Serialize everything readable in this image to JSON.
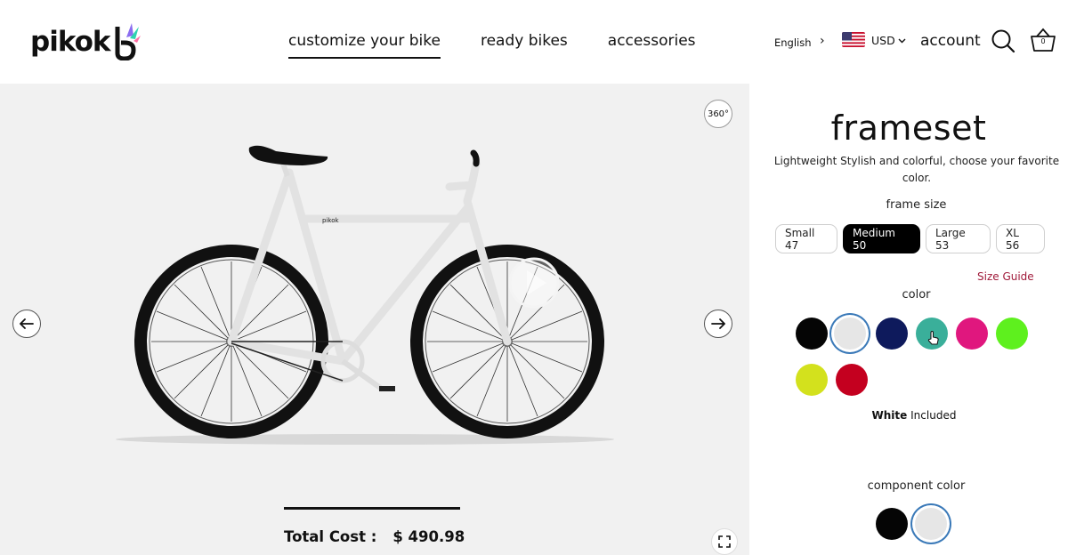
{
  "header": {
    "logo_text": "pikok",
    "nav": [
      {
        "label": "customize your bike",
        "active": true
      },
      {
        "label": "ready bikes",
        "active": false
      },
      {
        "label": "accessories",
        "active": false
      }
    ],
    "language": "English",
    "currency": "USD",
    "account_label": "account",
    "cart_count": "0"
  },
  "stage": {
    "rotate_label": "360°",
    "bike_brand_mark": "pikok",
    "total_label": "Total Cost :",
    "total_value": "$ 490.98"
  },
  "panel": {
    "title": "frameset",
    "description": "Lightweight Stylish and colorful, choose your favorite color.",
    "frame_size_label": "frame size",
    "sizes": [
      {
        "label": "Small 47",
        "selected": false
      },
      {
        "label": "Medium 50",
        "selected": true
      },
      {
        "label": "Large 53",
        "selected": false
      },
      {
        "label": "XL 56",
        "selected": false
      }
    ],
    "size_guide_label": "Size Guide",
    "color_label": "color",
    "colors": [
      {
        "name": "black",
        "hex": "#050505",
        "selected": false
      },
      {
        "name": "white",
        "hex": "#e6e6e6",
        "selected": true
      },
      {
        "name": "navy",
        "hex": "#0e1a5c",
        "selected": false
      },
      {
        "name": "teal",
        "hex": "#3aaf9a",
        "selected": false
      },
      {
        "name": "pink",
        "hex": "#e0177e",
        "selected": false
      },
      {
        "name": "lime",
        "hex": "#5ef01e",
        "selected": false
      },
      {
        "name": "yellow-green",
        "hex": "#d3e11d",
        "selected": false
      },
      {
        "name": "red",
        "hex": "#c4001f",
        "selected": false
      }
    ],
    "selected_color_name": "White",
    "selected_color_note": "Included",
    "component_color_label": "component color",
    "component_colors": [
      {
        "name": "black",
        "hex": "#050505",
        "selected": false
      },
      {
        "name": "white",
        "hex": "#e6e6e6",
        "selected": true
      }
    ]
  },
  "colors": {
    "accent": "#3a79b8",
    "size_guide": "#a01a3a",
    "stage_bg": "#f1f1f1"
  }
}
